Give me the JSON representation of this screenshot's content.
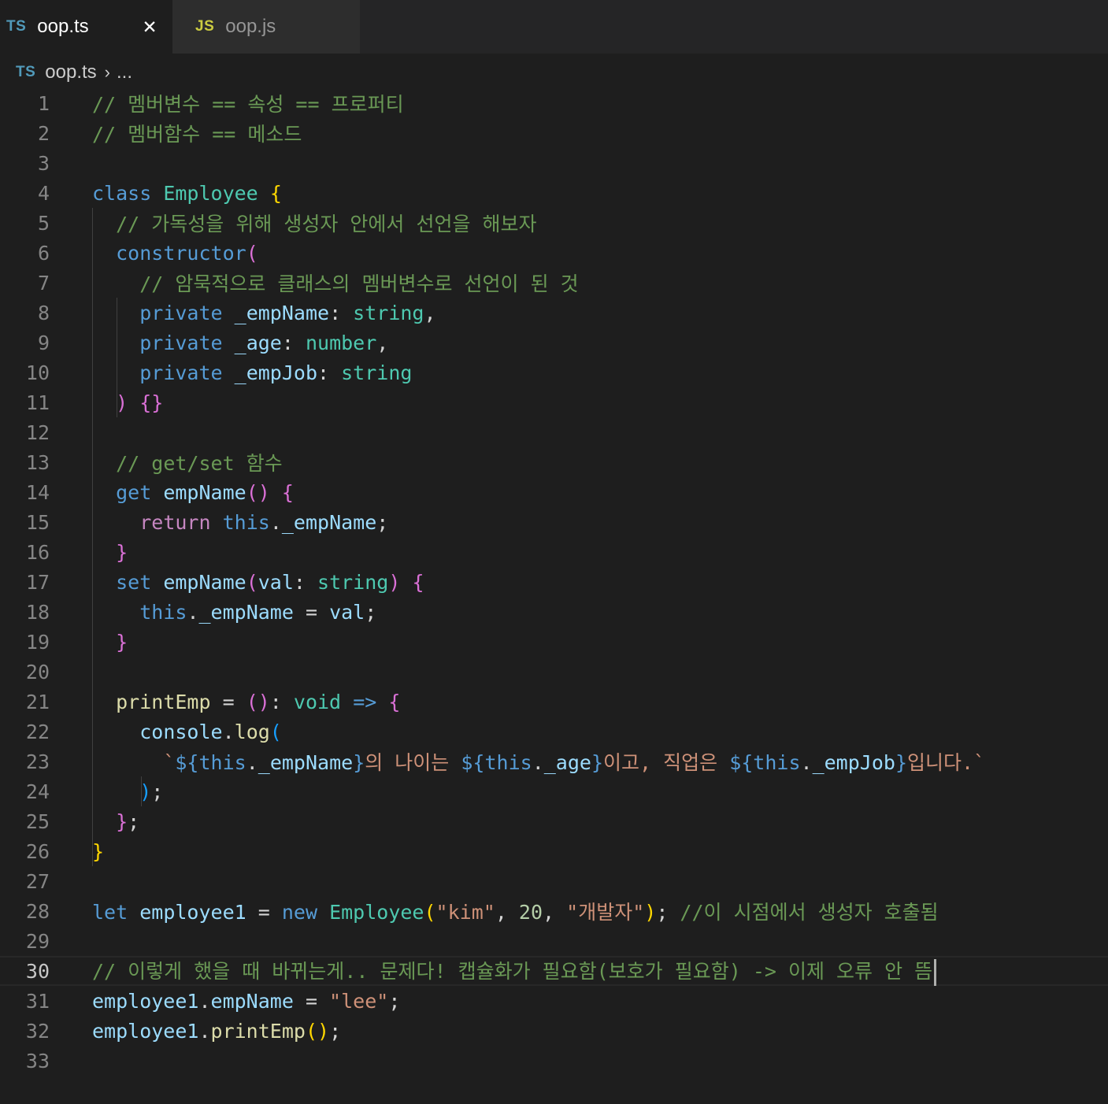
{
  "tabs": [
    {
      "badge": "TS",
      "label": "oop.ts",
      "active": true,
      "close": "✕"
    },
    {
      "badge": "JS",
      "label": "oop.js",
      "active": false
    }
  ],
  "breadcrumb": {
    "badge": "TS",
    "file": "oop.ts",
    "separator": "›",
    "rest": "..."
  },
  "editor": {
    "current_line": 30,
    "lines": [
      {
        "n": "1",
        "tokens": [
          {
            "t": "// 멤버변수 == 속성 == 프로퍼티",
            "c": "comment"
          }
        ]
      },
      {
        "n": "2",
        "tokens": [
          {
            "t": "// 멤버함수 == 메소드",
            "c": "comment"
          }
        ]
      },
      {
        "n": "3",
        "tokens": []
      },
      {
        "n": "4",
        "tokens": [
          {
            "t": "class",
            "c": "keyword"
          },
          {
            "t": " "
          },
          {
            "t": "Employee",
            "c": "type"
          },
          {
            "t": " "
          },
          {
            "t": "{",
            "c": "b1"
          }
        ]
      },
      {
        "n": "5",
        "tokens": [
          {
            "t": "  "
          },
          {
            "t": "// 가독성을 위해 생성자 안에서 선언을 해보자",
            "c": "comment"
          }
        ]
      },
      {
        "n": "6",
        "tokens": [
          {
            "t": "  "
          },
          {
            "t": "constructor",
            "c": "keyword"
          },
          {
            "t": "(",
            "c": "b2"
          }
        ]
      },
      {
        "n": "7",
        "tokens": [
          {
            "t": "    "
          },
          {
            "t": "// 암묵적으로 클래스의 멤버변수로 선언이 된 것",
            "c": "comment"
          }
        ]
      },
      {
        "n": "8",
        "tokens": [
          {
            "t": "    "
          },
          {
            "t": "private",
            "c": "keyword"
          },
          {
            "t": " "
          },
          {
            "t": "_empName",
            "c": "var"
          },
          {
            "t": ": "
          },
          {
            "t": "string",
            "c": "type"
          },
          {
            "t": ","
          }
        ]
      },
      {
        "n": "9",
        "tokens": [
          {
            "t": "    "
          },
          {
            "t": "private",
            "c": "keyword"
          },
          {
            "t": " "
          },
          {
            "t": "_age",
            "c": "var"
          },
          {
            "t": ": "
          },
          {
            "t": "number",
            "c": "type"
          },
          {
            "t": ","
          }
        ]
      },
      {
        "n": "10",
        "tokens": [
          {
            "t": "    "
          },
          {
            "t": "private",
            "c": "keyword"
          },
          {
            "t": " "
          },
          {
            "t": "_empJob",
            "c": "var"
          },
          {
            "t": ": "
          },
          {
            "t": "string",
            "c": "type"
          }
        ]
      },
      {
        "n": "11",
        "tokens": [
          {
            "t": "  "
          },
          {
            "t": ")",
            "c": "b2"
          },
          {
            "t": " "
          },
          {
            "t": "{}",
            "c": "b2"
          }
        ]
      },
      {
        "n": "12",
        "tokens": []
      },
      {
        "n": "13",
        "tokens": [
          {
            "t": "  "
          },
          {
            "t": "// get/set 함수",
            "c": "comment"
          }
        ]
      },
      {
        "n": "14",
        "tokens": [
          {
            "t": "  "
          },
          {
            "t": "get",
            "c": "keyword"
          },
          {
            "t": " "
          },
          {
            "t": "empName",
            "c": "var"
          },
          {
            "t": "()",
            "c": "b2"
          },
          {
            "t": " "
          },
          {
            "t": "{",
            "c": "b2"
          }
        ]
      },
      {
        "n": "15",
        "tokens": [
          {
            "t": "    "
          },
          {
            "t": "return",
            "c": "control"
          },
          {
            "t": " "
          },
          {
            "t": "this",
            "c": "keyword"
          },
          {
            "t": "."
          },
          {
            "t": "_empName",
            "c": "var"
          },
          {
            "t": ";"
          }
        ]
      },
      {
        "n": "16",
        "tokens": [
          {
            "t": "  "
          },
          {
            "t": "}",
            "c": "b2"
          }
        ]
      },
      {
        "n": "17",
        "tokens": [
          {
            "t": "  "
          },
          {
            "t": "set",
            "c": "keyword"
          },
          {
            "t": " "
          },
          {
            "t": "empName",
            "c": "var"
          },
          {
            "t": "(",
            "c": "b2"
          },
          {
            "t": "val",
            "c": "var"
          },
          {
            "t": ": "
          },
          {
            "t": "string",
            "c": "type"
          },
          {
            "t": ")",
            "c": "b2"
          },
          {
            "t": " "
          },
          {
            "t": "{",
            "c": "b2"
          }
        ]
      },
      {
        "n": "18",
        "tokens": [
          {
            "t": "    "
          },
          {
            "t": "this",
            "c": "keyword"
          },
          {
            "t": "."
          },
          {
            "t": "_empName",
            "c": "var"
          },
          {
            "t": " = "
          },
          {
            "t": "val",
            "c": "var"
          },
          {
            "t": ";"
          }
        ]
      },
      {
        "n": "19",
        "tokens": [
          {
            "t": "  "
          },
          {
            "t": "}",
            "c": "b2"
          }
        ]
      },
      {
        "n": "20",
        "tokens": []
      },
      {
        "n": "21",
        "tokens": [
          {
            "t": "  "
          },
          {
            "t": "printEmp",
            "c": "func"
          },
          {
            "t": " = "
          },
          {
            "t": "()",
            "c": "b2"
          },
          {
            "t": ": "
          },
          {
            "t": "void",
            "c": "type"
          },
          {
            "t": " "
          },
          {
            "t": "=>",
            "c": "keyword"
          },
          {
            "t": " "
          },
          {
            "t": "{",
            "c": "b2"
          }
        ]
      },
      {
        "n": "22",
        "tokens": [
          {
            "t": "    "
          },
          {
            "t": "console",
            "c": "var"
          },
          {
            "t": "."
          },
          {
            "t": "log",
            "c": "func"
          },
          {
            "t": "(",
            "c": "b3"
          }
        ]
      },
      {
        "n": "23",
        "tokens": [
          {
            "t": "      "
          },
          {
            "t": "`",
            "c": "string"
          },
          {
            "t": "${",
            "c": "keyword"
          },
          {
            "t": "this",
            "c": "keyword"
          },
          {
            "t": "."
          },
          {
            "t": "_empName",
            "c": "var"
          },
          {
            "t": "}",
            "c": "keyword"
          },
          {
            "t": "의 나이는 ",
            "c": "string"
          },
          {
            "t": "${",
            "c": "keyword"
          },
          {
            "t": "this",
            "c": "keyword"
          },
          {
            "t": "."
          },
          {
            "t": "_age",
            "c": "var"
          },
          {
            "t": "}",
            "c": "keyword"
          },
          {
            "t": "이고, 직업은 ",
            "c": "string"
          },
          {
            "t": "${",
            "c": "keyword"
          },
          {
            "t": "this",
            "c": "keyword"
          },
          {
            "t": "."
          },
          {
            "t": "_empJob",
            "c": "var"
          },
          {
            "t": "}",
            "c": "keyword"
          },
          {
            "t": "입니다.`",
            "c": "string"
          }
        ]
      },
      {
        "n": "24",
        "tokens": [
          {
            "t": "    "
          },
          {
            "t": ")",
            "c": "b3"
          },
          {
            "t": ";"
          }
        ]
      },
      {
        "n": "25",
        "tokens": [
          {
            "t": "  "
          },
          {
            "t": "}",
            "c": "b2"
          },
          {
            "t": ";"
          }
        ]
      },
      {
        "n": "26",
        "tokens": [
          {
            "t": "}",
            "c": "b1"
          }
        ]
      },
      {
        "n": "27",
        "tokens": []
      },
      {
        "n": "28",
        "tokens": [
          {
            "t": "let",
            "c": "keyword"
          },
          {
            "t": " "
          },
          {
            "t": "employee1",
            "c": "var"
          },
          {
            "t": " = "
          },
          {
            "t": "new",
            "c": "keyword"
          },
          {
            "t": " "
          },
          {
            "t": "Employee",
            "c": "type"
          },
          {
            "t": "(",
            "c": "b1"
          },
          {
            "t": "\"kim\"",
            "c": "string"
          },
          {
            "t": ", "
          },
          {
            "t": "20",
            "c": "number"
          },
          {
            "t": ", "
          },
          {
            "t": "\"개발자\"",
            "c": "string"
          },
          {
            "t": ")",
            "c": "b1"
          },
          {
            "t": "; "
          },
          {
            "t": "//이 시점에서 생성자 호출됨",
            "c": "comment"
          }
        ]
      },
      {
        "n": "29",
        "tokens": []
      },
      {
        "n": "30",
        "tokens": [
          {
            "t": "// 이렇게 했을 때 바뀌는게.. 문제다! 캡슐화가 필요함(보호가 필요함) -> 이제 오류 안 뜸",
            "c": "comment"
          }
        ]
      },
      {
        "n": "31",
        "tokens": [
          {
            "t": "employee1",
            "c": "var"
          },
          {
            "t": "."
          },
          {
            "t": "empName",
            "c": "var"
          },
          {
            "t": " = "
          },
          {
            "t": "\"lee\"",
            "c": "string"
          },
          {
            "t": ";"
          }
        ]
      },
      {
        "n": "32",
        "tokens": [
          {
            "t": "employee1",
            "c": "var"
          },
          {
            "t": "."
          },
          {
            "t": "printEmp",
            "c": "func"
          },
          {
            "t": "()",
            "c": "b1"
          },
          {
            "t": ";"
          }
        ]
      },
      {
        "n": "33",
        "tokens": []
      }
    ]
  }
}
